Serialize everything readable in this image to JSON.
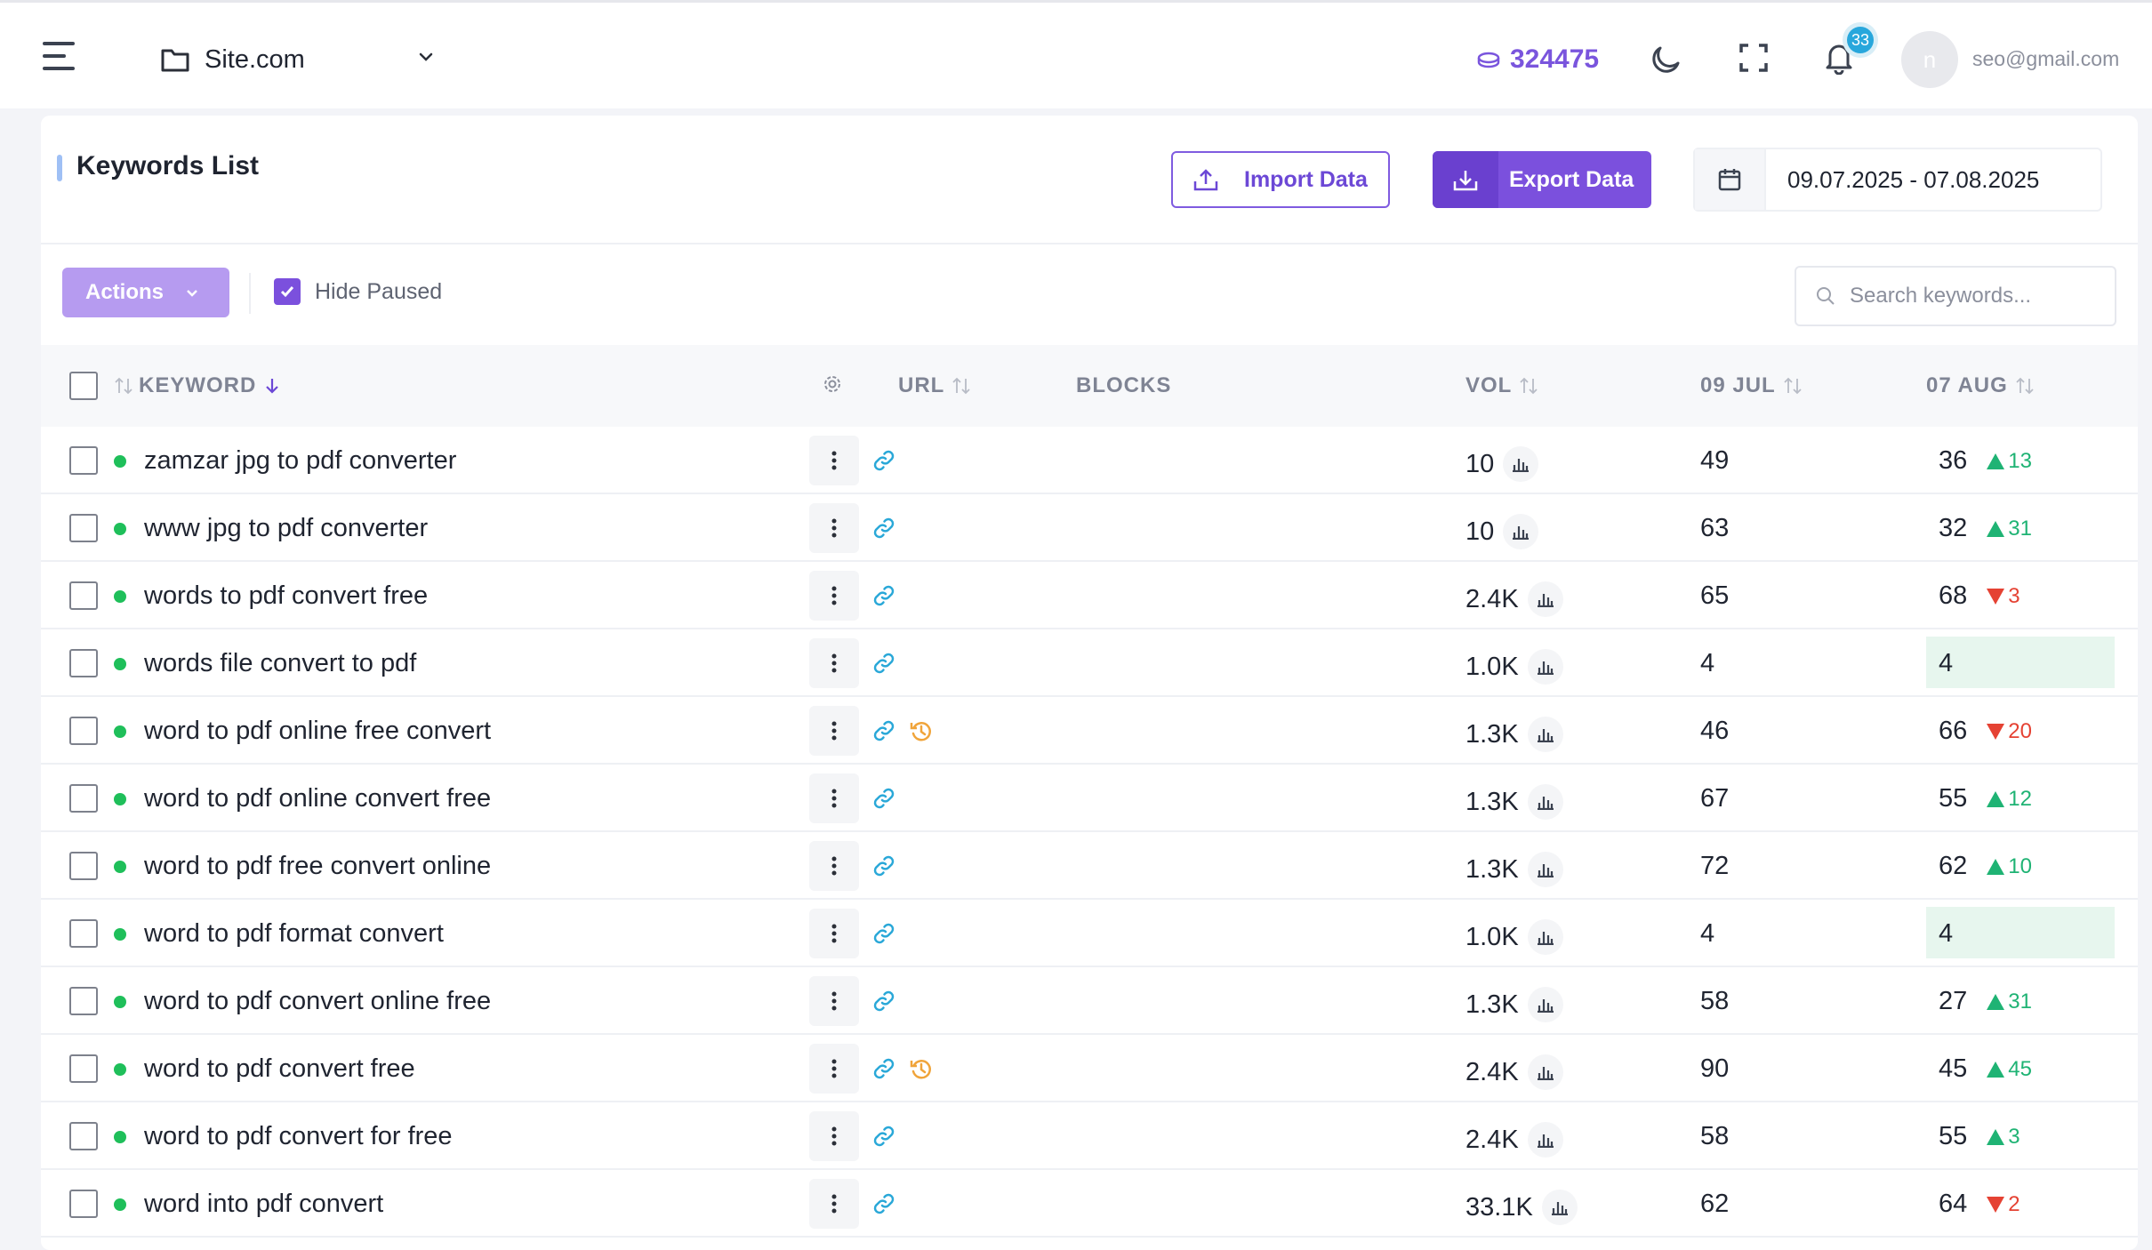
{
  "header": {
    "site_name": "Site.com",
    "credits": "324475",
    "notifications_count": "33",
    "avatar_initial": "n",
    "user_email": "seo@gmail.com"
  },
  "card": {
    "title": "Keywords List",
    "import_label": "Import Data",
    "export_label": "Export Data",
    "date_range": "09.07.2025 - 07.08.2025"
  },
  "toolbar": {
    "actions_label": "Actions",
    "hide_paused_label": "Hide Paused",
    "hide_paused_checked": true,
    "search_placeholder": "Search keywords..."
  },
  "table": {
    "columns": {
      "keyword": "KEYWORD",
      "url": "URL",
      "blocks": "BLOCKS",
      "vol": "VOL",
      "date1": "09 JUL",
      "date2": "07 AUG"
    },
    "rows": [
      {
        "keyword": "zamzar jpg to pdf converter",
        "vol": "10",
        "jul": "49",
        "aug": "36",
        "change": "13",
        "dir": "up",
        "history": false,
        "highlight": false
      },
      {
        "keyword": "www jpg to pdf converter",
        "vol": "10",
        "jul": "63",
        "aug": "32",
        "change": "31",
        "dir": "up",
        "history": false,
        "highlight": false
      },
      {
        "keyword": "words to pdf convert free",
        "vol": "2.4K",
        "jul": "65",
        "aug": "68",
        "change": "3",
        "dir": "down",
        "history": false,
        "highlight": false
      },
      {
        "keyword": "words file convert to pdf",
        "vol": "1.0K",
        "jul": "4",
        "aug": "4",
        "change": "",
        "dir": "none",
        "history": false,
        "highlight": true
      },
      {
        "keyword": "word to pdf online free convert",
        "vol": "1.3K",
        "jul": "46",
        "aug": "66",
        "change": "20",
        "dir": "down",
        "history": true,
        "highlight": false
      },
      {
        "keyword": "word to pdf online convert free",
        "vol": "1.3K",
        "jul": "67",
        "aug": "55",
        "change": "12",
        "dir": "up",
        "history": false,
        "highlight": false
      },
      {
        "keyword": "word to pdf free convert online",
        "vol": "1.3K",
        "jul": "72",
        "aug": "62",
        "change": "10",
        "dir": "up",
        "history": false,
        "highlight": false
      },
      {
        "keyword": "word to pdf format convert",
        "vol": "1.0K",
        "jul": "4",
        "aug": "4",
        "change": "",
        "dir": "none",
        "history": false,
        "highlight": true
      },
      {
        "keyword": "word to pdf convert online free",
        "vol": "1.3K",
        "jul": "58",
        "aug": "27",
        "change": "31",
        "dir": "up",
        "history": false,
        "highlight": false
      },
      {
        "keyword": "word to pdf convert free",
        "vol": "2.4K",
        "jul": "90",
        "aug": "45",
        "change": "45",
        "dir": "up",
        "history": true,
        "highlight": false
      },
      {
        "keyword": "word to pdf convert for free",
        "vol": "2.4K",
        "jul": "58",
        "aug": "55",
        "change": "3",
        "dir": "up",
        "history": false,
        "highlight": false
      },
      {
        "keyword": "word into pdf convert",
        "vol": "33.1K",
        "jul": "62",
        "aug": "64",
        "change": "2",
        "dir": "down",
        "history": false,
        "highlight": false
      }
    ]
  },
  "colors": {
    "accent": "#7b50dd",
    "up": "#1fb374",
    "down": "#e54233",
    "active_dot": "#1fbf5a",
    "link": "#2aa8d8",
    "history": "#f0a43a"
  }
}
